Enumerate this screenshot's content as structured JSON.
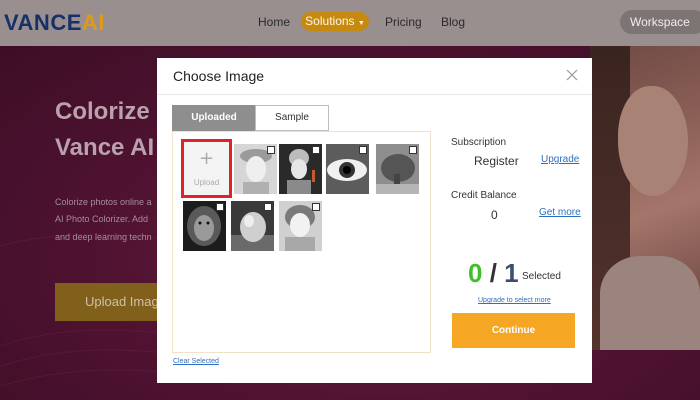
{
  "header": {
    "logo_main": "VANCE",
    "logo_accent": "AI",
    "nav": {
      "home": "Home",
      "solutions": "Solutions",
      "pricing": "Pricing",
      "blog": "Blog",
      "workspace": "Workspace"
    },
    "icons": {
      "solutions_caret": "caret-down-icon",
      "workspace_caret": "caret-down-icon"
    }
  },
  "hero": {
    "title_line1": "Colorize I",
    "title_line2": "Vance AI",
    "desc_line1": "Colorize photos online a",
    "desc_line2": "AI Photo Colorizer. Add",
    "desc_line3": "and deep learning techn",
    "cta": "Upload Image"
  },
  "modal": {
    "title": "Choose Image",
    "close_icon": "close-icon",
    "tabs": {
      "uploaded": "Uploaded",
      "sample": "Sample",
      "active": "uploaded"
    },
    "upload_tile": {
      "icon": "plus-icon",
      "label": "Upload"
    },
    "thumbnails": [
      {
        "subject": "girl-with-wreath",
        "checked": false
      },
      {
        "subject": "girl-with-pearl-earring",
        "checked": false
      },
      {
        "subject": "eye-closeup",
        "checked": false
      },
      {
        "subject": "elephant",
        "checked": false
      },
      {
        "subject": "lion",
        "checked": false
      },
      {
        "subject": "egg",
        "checked": false
      },
      {
        "subject": "girl-smiling",
        "checked": false
      }
    ],
    "clear_selected": "Clear Selected",
    "subscription": {
      "label": "Subscription",
      "value": "Register",
      "link": "Upgrade"
    },
    "credit": {
      "label": "Credit Balance",
      "value": "0",
      "link": "Get more"
    },
    "counter": {
      "selected": "0",
      "separator": "/",
      "total": "1",
      "label": "Selected"
    },
    "upgrade_to_select": "Upgrade to select more",
    "continue": "Continue"
  },
  "colors": {
    "accent_orange": "#f5a623",
    "highlight_red": "#e0222b",
    "count_green": "#3fbf2a",
    "count_total": "#3a4f6b",
    "link_blue": "#2f6fbf",
    "logo_navy": "#17306a",
    "logo_orange": "#e09a18"
  }
}
